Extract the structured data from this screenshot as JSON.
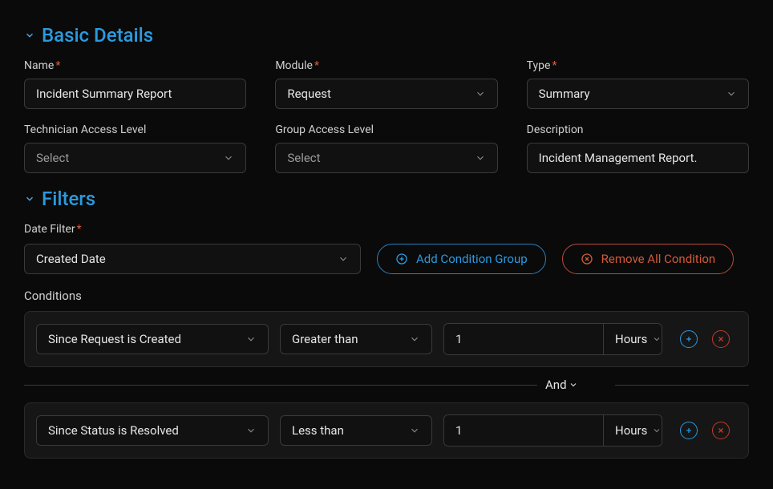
{
  "basic": {
    "heading": "Basic Details",
    "name_label": "Name",
    "name_value": "Incident Summary Report",
    "module_label": "Module",
    "module_value": "Request",
    "type_label": "Type",
    "type_value": "Summary",
    "tech_access_label": "Technician Access Level",
    "tech_access_value": "Select",
    "group_access_label": "Group Access Level",
    "group_access_value": "Select",
    "description_label": "Description",
    "description_value": "Incident Management Report."
  },
  "filters": {
    "heading": "Filters",
    "date_filter_label": "Date Filter",
    "date_filter_value": "Created Date",
    "add_group_label": "Add Condition Group",
    "remove_all_label": "Remove All Condition",
    "conditions_label": "Conditions",
    "connector": "And",
    "rows": [
      {
        "field": "Since Request is Created",
        "op": "Greater than",
        "value": "1",
        "unit": "Hours"
      },
      {
        "field": "Since Status is Resolved",
        "op": "Less than",
        "value": "1",
        "unit": "Hours"
      }
    ]
  }
}
